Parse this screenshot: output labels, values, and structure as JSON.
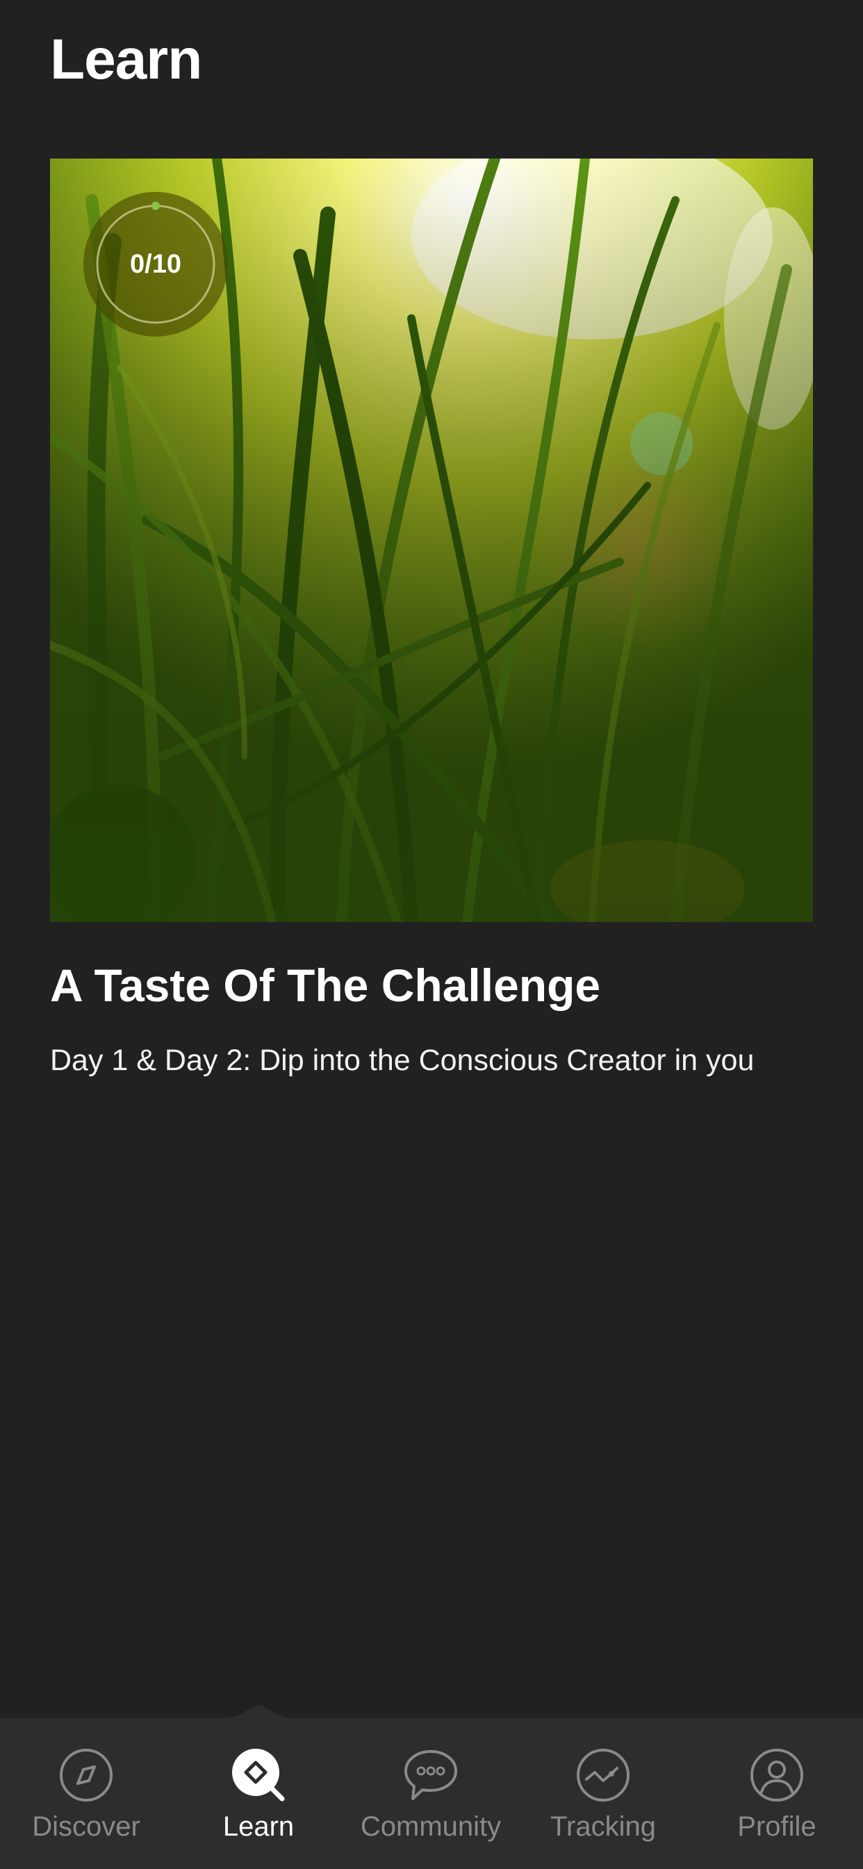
{
  "header": {
    "title": "Learn"
  },
  "course": {
    "progress_text": "0/10",
    "progress_fraction": 0.0,
    "title": "A Taste Of The Challenge",
    "subtitle": "Day 1 & Day 2: Dip into the Conscious Creator in you",
    "cover_image": "grass-sunlight-photo"
  },
  "tabbar": {
    "active": "learn",
    "items": [
      {
        "id": "discover",
        "label": "Discover",
        "icon": "compass-icon"
      },
      {
        "id": "learn",
        "label": "Learn",
        "icon": "learn-search-icon"
      },
      {
        "id": "community",
        "label": "Community",
        "icon": "chat-bubble-icon"
      },
      {
        "id": "tracking",
        "label": "Tracking",
        "icon": "chart-line-icon"
      },
      {
        "id": "profile",
        "label": "Profile",
        "icon": "user-icon"
      }
    ]
  },
  "colors": {
    "background": "#212121",
    "tabbar": "#2d2d2d",
    "inactive_tab": "#8a8a8a",
    "active_tab": "#ffffff",
    "progress_accent": "#8bc34a"
  }
}
